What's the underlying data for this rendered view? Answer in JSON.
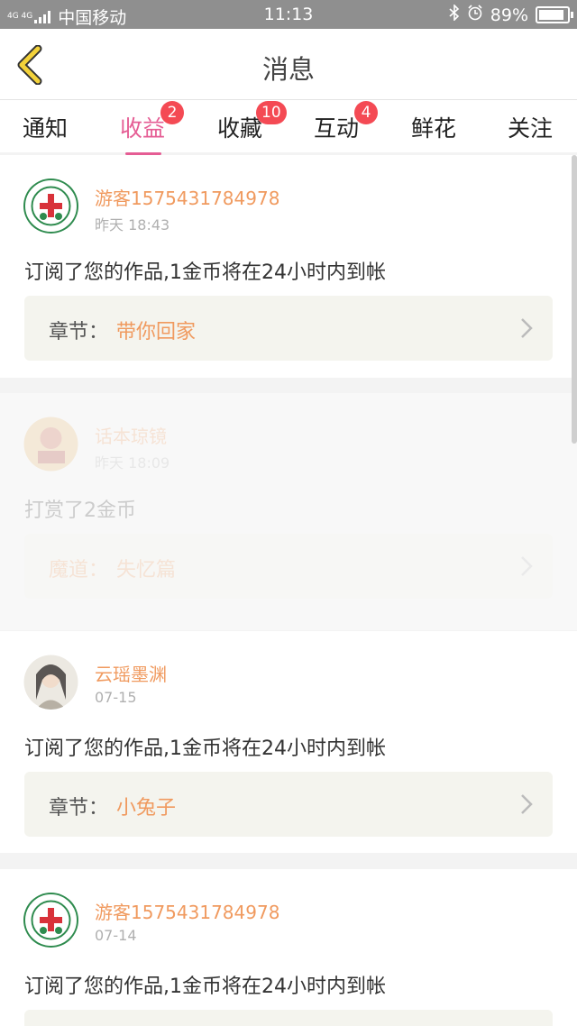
{
  "status_bar": {
    "network": "4G 4G",
    "carrier": "中国移动",
    "time": "11:13",
    "battery": "89%"
  },
  "header": {
    "title": "消息"
  },
  "tabs": [
    {
      "label": "通知"
    },
    {
      "label": "收益",
      "badge": "2",
      "active": true
    },
    {
      "label": "收藏",
      "badge": "10"
    },
    {
      "label": "互动",
      "badge": "4"
    },
    {
      "label": "鲜花"
    },
    {
      "label": "关注"
    }
  ],
  "messages": [
    {
      "user": "游客1575431784978",
      "time": "昨天 18:43",
      "text": "订阅了您的作品,1金币将在24小时内到帐",
      "chapter_label": "章节：",
      "chapter_value": "带你回家"
    },
    {
      "user": "话本琼镜",
      "time": "昨天 18:09",
      "text": "打赏了2金币",
      "chapter_label": "魔道：",
      "chapter_value": "失忆篇"
    },
    {
      "user": "云瑶墨渊",
      "time": "07-15",
      "text": "订阅了您的作品,1金币将在24小时内到帐",
      "chapter_label": "章节：",
      "chapter_value": "小兔子"
    },
    {
      "user": "游客1575431784978",
      "time": "07-14",
      "text": "订阅了您的作品,1金币将在24小时内到帐"
    }
  ],
  "colors": {
    "accent": "#e55d94",
    "badge": "#f44a54",
    "username": "#f09a5f",
    "status_bar": "#8f8f8f"
  }
}
